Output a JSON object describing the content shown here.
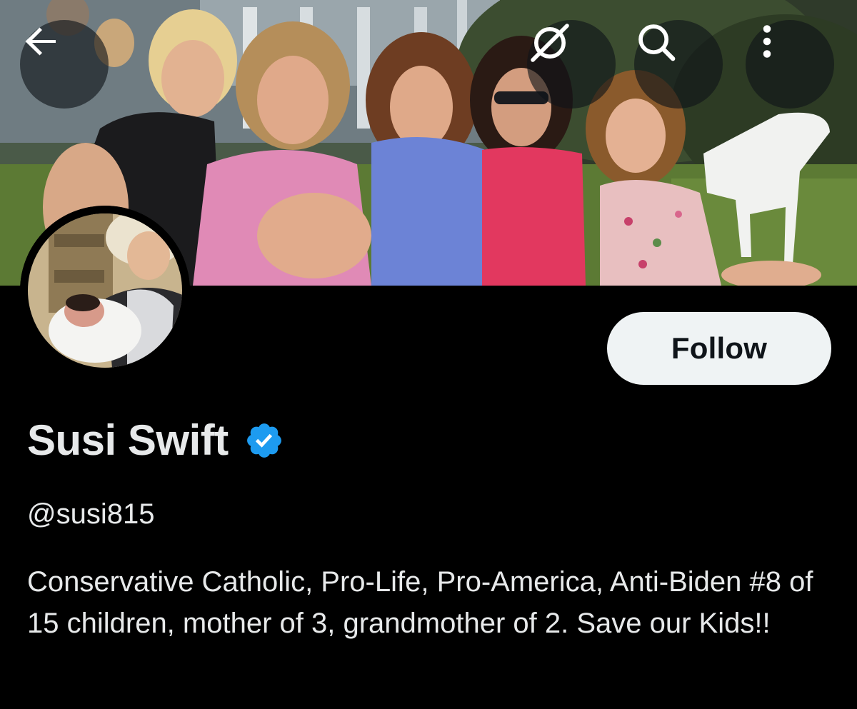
{
  "header": {
    "back_icon": "arrow-left-icon",
    "grok_icon": "grok-icon",
    "search_icon": "search-icon",
    "more_icon": "more-vertical-icon"
  },
  "profile": {
    "display_name": "Susi Swift",
    "handle": "@susi815",
    "verified_color": "#1d9bf0",
    "bio": "Conservative Catholic, Pro-Life, Pro-America, Anti-Biden #8 of 15 children, mother of 3, grandmother of 2. Save our Kids!!"
  },
  "actions": {
    "follow_label": "Follow"
  },
  "colors": {
    "background": "#000000",
    "text": "#e7e9ea",
    "follow_bg": "#eff3f4",
    "follow_text": "#0f1419"
  }
}
